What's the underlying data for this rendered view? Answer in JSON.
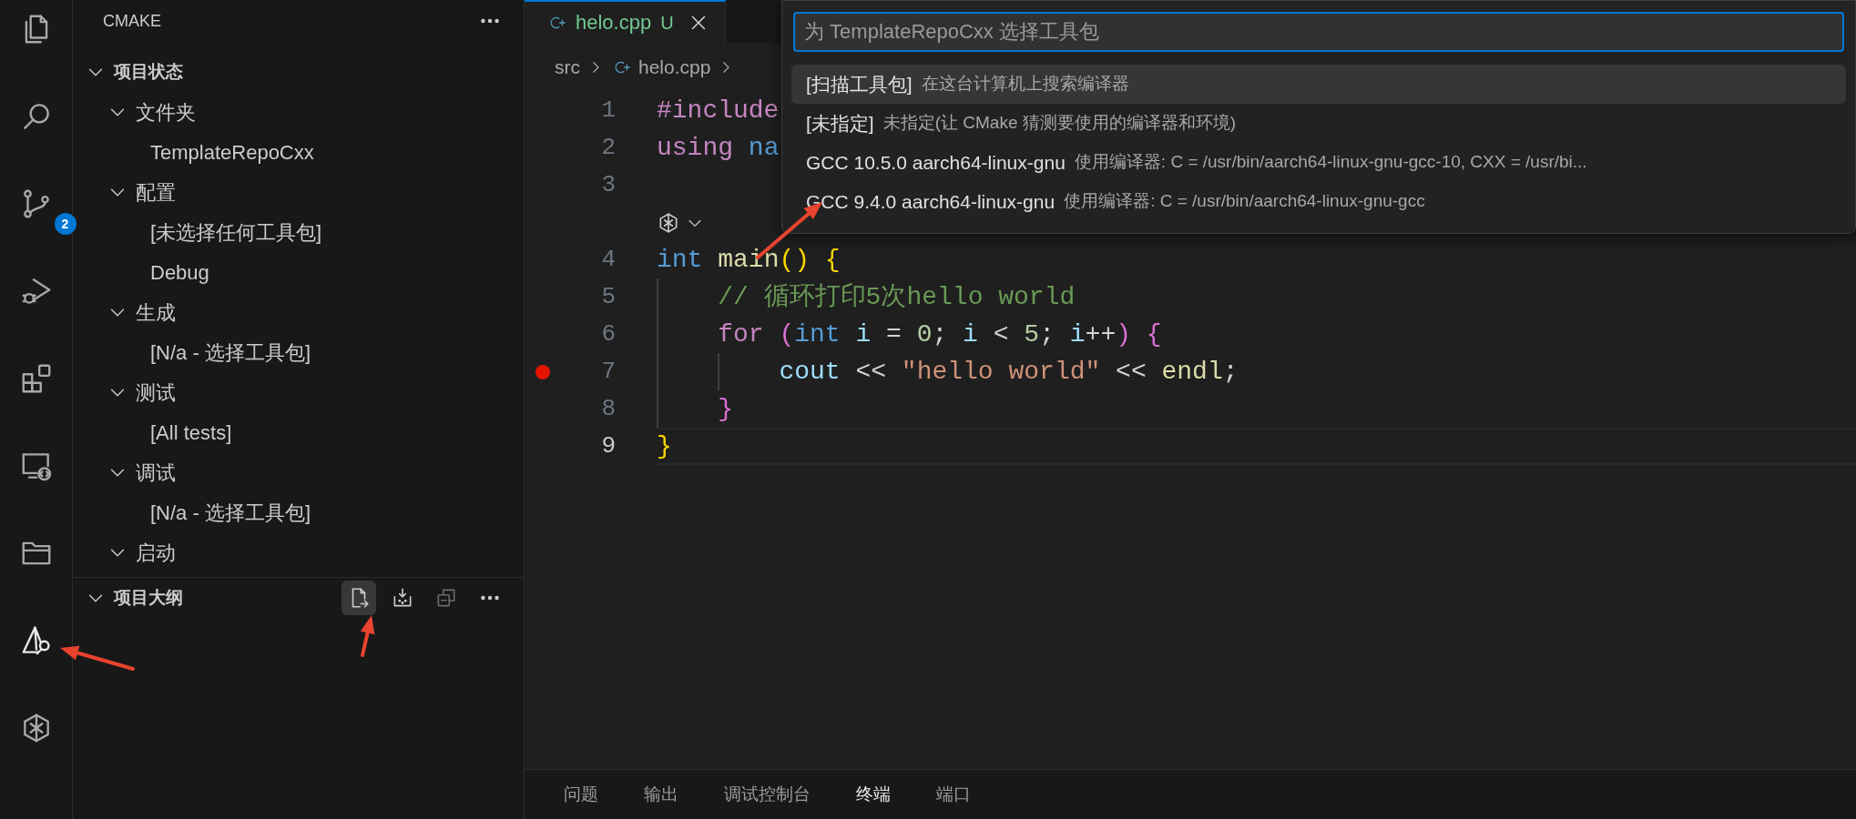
{
  "activity_bar": [
    {
      "selected": false
    },
    {
      "selected": false
    },
    {
      "selected": false,
      "badge": "2"
    },
    {
      "selected": false
    },
    {
      "selected": false
    },
    {
      "selected": false
    },
    {
      "selected": false
    },
    {
      "selected": true
    },
    {
      "selected": false
    }
  ],
  "sidebar": {
    "title": "CMAKE",
    "sections": [
      {
        "title": "项目状态",
        "expanded": true,
        "items": [
          {
            "label": "文件夹",
            "expanded": true,
            "children": [
              {
                "label": "TemplateRepoCxx"
              }
            ]
          },
          {
            "label": "配置",
            "expanded": true,
            "children": [
              {
                "label": "[未选择任何工具包]"
              },
              {
                "label": "Debug"
              }
            ]
          },
          {
            "label": "生成",
            "expanded": true,
            "children": [
              {
                "label": "[N/a - 选择工具包]"
              }
            ]
          },
          {
            "label": "测试",
            "expanded": true,
            "children": [
              {
                "label": "[All tests]"
              }
            ]
          },
          {
            "label": "调试",
            "expanded": true,
            "children": [
              {
                "label": "[N/a - 选择工具包]"
              }
            ]
          },
          {
            "label": "启动",
            "expanded": true
          }
        ]
      },
      {
        "title": "项目大纲",
        "expanded": true,
        "actions": [
          {
            "hovered": true,
            "disabled": false
          },
          {
            "hovered": false,
            "disabled": false
          },
          {
            "hovered": false,
            "disabled": true
          },
          {
            "hovered": false,
            "disabled": false
          }
        ]
      }
    ]
  },
  "editor": {
    "tabs": [
      {
        "label": "helo.cpp",
        "status": "U",
        "selected": true
      }
    ],
    "breadcrumb": [
      "src",
      "helo.cpp"
    ],
    "lines": [
      {
        "kind": "code",
        "number": "1",
        "tokens": [
          {
            "text": "#include",
            "kind": "keyword"
          }
        ]
      },
      {
        "kind": "code",
        "number": "2",
        "tokens": [
          {
            "text": "using ",
            "kind": "keyword"
          },
          {
            "text": "na",
            "kind": "type"
          }
        ]
      },
      {
        "kind": "code",
        "number": "3"
      },
      {
        "kind": "codelens"
      },
      {
        "kind": "code",
        "number": "4",
        "tokens": [
          {
            "text": "int ",
            "kind": "type"
          },
          {
            "text": "main",
            "kind": "function"
          },
          {
            "text": "()",
            "kind": "bracket1"
          },
          {
            "text": " {",
            "kind": "bracket1"
          }
        ]
      },
      {
        "kind": "code",
        "number": "5",
        "tokens": [
          {
            "text": "    // 循环打印5次hello world",
            "kind": "comment"
          }
        ]
      },
      {
        "kind": "code",
        "number": "6",
        "tokens": [
          {
            "text": "    for",
            "kind": "keyword"
          },
          {
            "text": " (",
            "kind": "bracket2"
          },
          {
            "text": "int",
            "kind": "type"
          },
          {
            "text": " i",
            "kind": "variable"
          },
          {
            "text": " = ",
            "kind": "plain"
          },
          {
            "text": "0",
            "kind": "number"
          },
          {
            "text": "; ",
            "kind": "plain"
          },
          {
            "text": "i",
            "kind": "variable"
          },
          {
            "text": " < ",
            "kind": "plain"
          },
          {
            "text": "5",
            "kind": "number"
          },
          {
            "text": "; ",
            "kind": "plain"
          },
          {
            "text": "i",
            "kind": "variable"
          },
          {
            "text": "++",
            "kind": "plain"
          },
          {
            "text": ")",
            "kind": "bracket2"
          },
          {
            "text": " {",
            "kind": "bracket2"
          }
        ]
      },
      {
        "kind": "code",
        "number": "7",
        "breakpoint": true,
        "tokens": [
          {
            "text": "        cout",
            "kind": "variable"
          },
          {
            "text": " << ",
            "kind": "plain"
          },
          {
            "text": "\"hello world\"",
            "kind": "string"
          },
          {
            "text": " << ",
            "kind": "plain"
          },
          {
            "text": "endl",
            "kind": "function"
          },
          {
            "text": ";",
            "kind": "plain"
          }
        ]
      },
      {
        "kind": "code",
        "number": "8",
        "tokens": [
          {
            "text": "    }",
            "kind": "bracket2"
          }
        ]
      },
      {
        "kind": "code",
        "number": "9",
        "current": true,
        "tokens": [
          {
            "text": "}",
            "kind": "bracket1"
          }
        ]
      }
    ]
  },
  "quick_pick": {
    "placeholder": "为 TemplateRepoCxx 选择工具包",
    "items": [
      {
        "label": "[扫描工具包]",
        "description": "在这台计算机上搜索编译器",
        "selected": true
      },
      {
        "label": "[未指定]",
        "description": "未指定(让 CMake 猜测要使用的编译器和环境)",
        "selected": false
      },
      {
        "label": "GCC 10.5.0 aarch64-linux-gnu",
        "description": "使用编译器: C = /usr/bin/aarch64-linux-gnu-gcc-10, CXX = /usr/bi...",
        "selected": false
      },
      {
        "label": "GCC 9.4.0 aarch64-linux-gnu",
        "description": "使用编译器: C = /usr/bin/aarch64-linux-gnu-gcc",
        "selected": false
      }
    ]
  },
  "panel": {
    "tabs": [
      {
        "label": "问题",
        "selected": false
      },
      {
        "label": "输出",
        "selected": false
      },
      {
        "label": "调试控制台",
        "selected": false
      },
      {
        "label": "终端",
        "selected": true
      },
      {
        "label": "端口",
        "selected": false
      }
    ]
  }
}
